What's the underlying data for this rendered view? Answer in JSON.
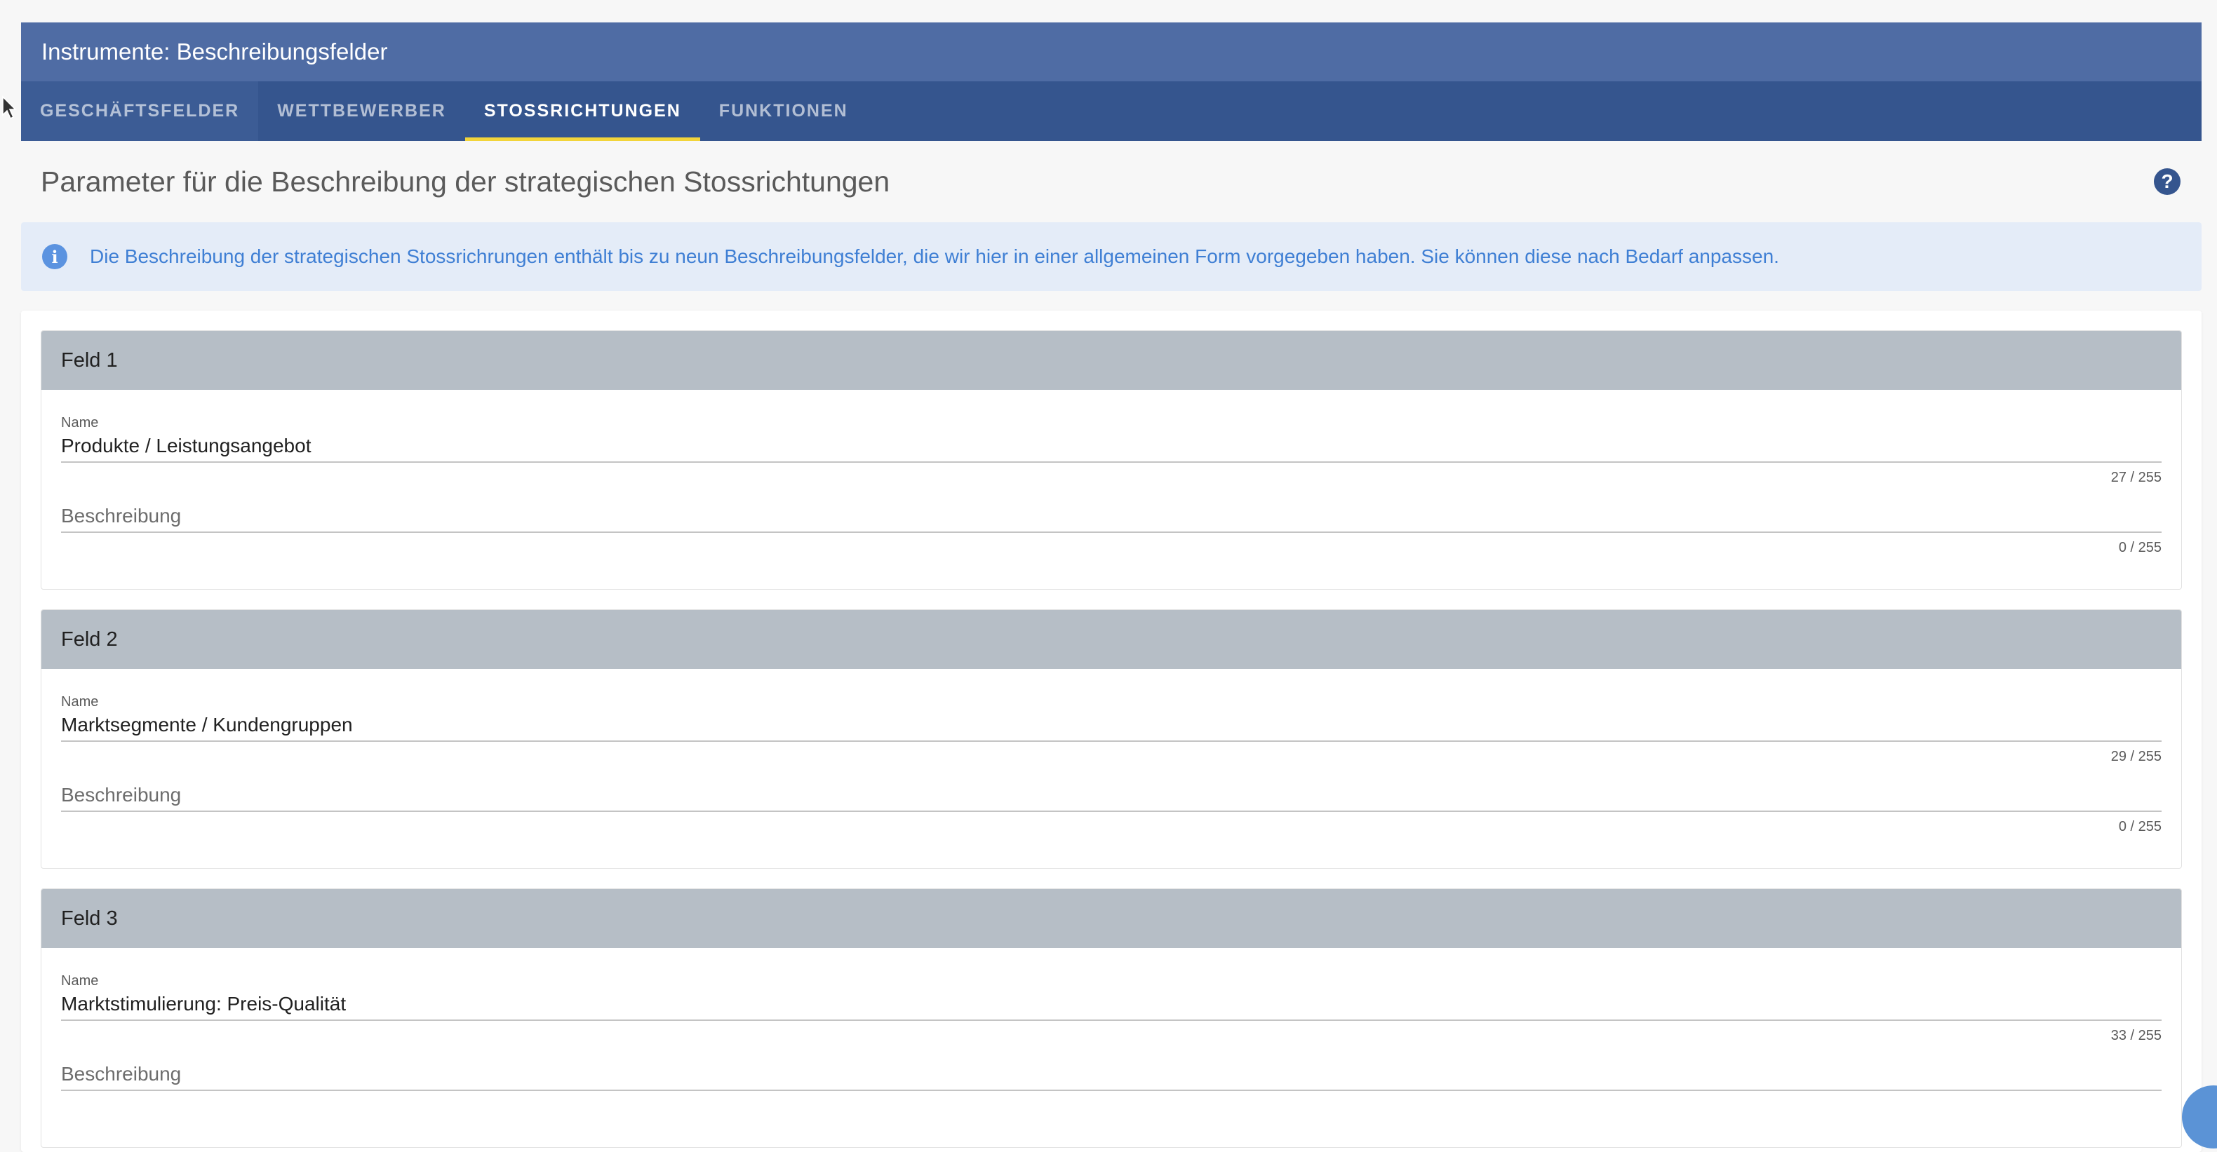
{
  "header": {
    "title": "Instrumente: Beschreibungsfelder"
  },
  "tabs": [
    {
      "label": "GESCHÄFTSFELDER"
    },
    {
      "label": "WETTBEWERBER"
    },
    {
      "label": "STOSSRICHTUNGEN"
    },
    {
      "label": "FUNKTIONEN"
    }
  ],
  "active_tab": "STOSSRICHTUNGEN",
  "page": {
    "title": "Parameter für die Beschreibung der strategischen Stossrichtungen",
    "help_symbol": "?"
  },
  "alert": {
    "icon_symbol": "i",
    "text": "Die Beschreibung der strategischen Stossrichrungen enthält bis zu neun Beschreibungsfelder, die wir hier in einer allgemeinen Form vorgegeben haben. Sie können diese nach Bedarf anpassen."
  },
  "fields": [
    {
      "title": "Feld 1",
      "name_label": "Name",
      "name_value": "Produkte / Leistungsangebot",
      "name_counter": "27 / 255",
      "desc_placeholder": "Beschreibung",
      "desc_counter": "0 / 255"
    },
    {
      "title": "Feld 2",
      "name_label": "Name",
      "name_value": "Marktsegmente / Kundengruppen",
      "name_counter": "29 / 255",
      "desc_placeholder": "Beschreibung",
      "desc_counter": "0 / 255"
    },
    {
      "title": "Feld 3",
      "name_label": "Name",
      "name_value": "Marktstimulierung: Preis-Qualität",
      "name_counter": "33 / 255",
      "desc_placeholder": "Beschreibung",
      "desc_counter": ""
    }
  ],
  "colors": {
    "header_bg": "#4f6ca4",
    "tabs_bg": "#35558e",
    "active_indicator": "#f2d43a",
    "alert_bg": "#e4ecf8",
    "alert_text": "#3f7fd4",
    "field_header_bg": "#b6bec6"
  }
}
